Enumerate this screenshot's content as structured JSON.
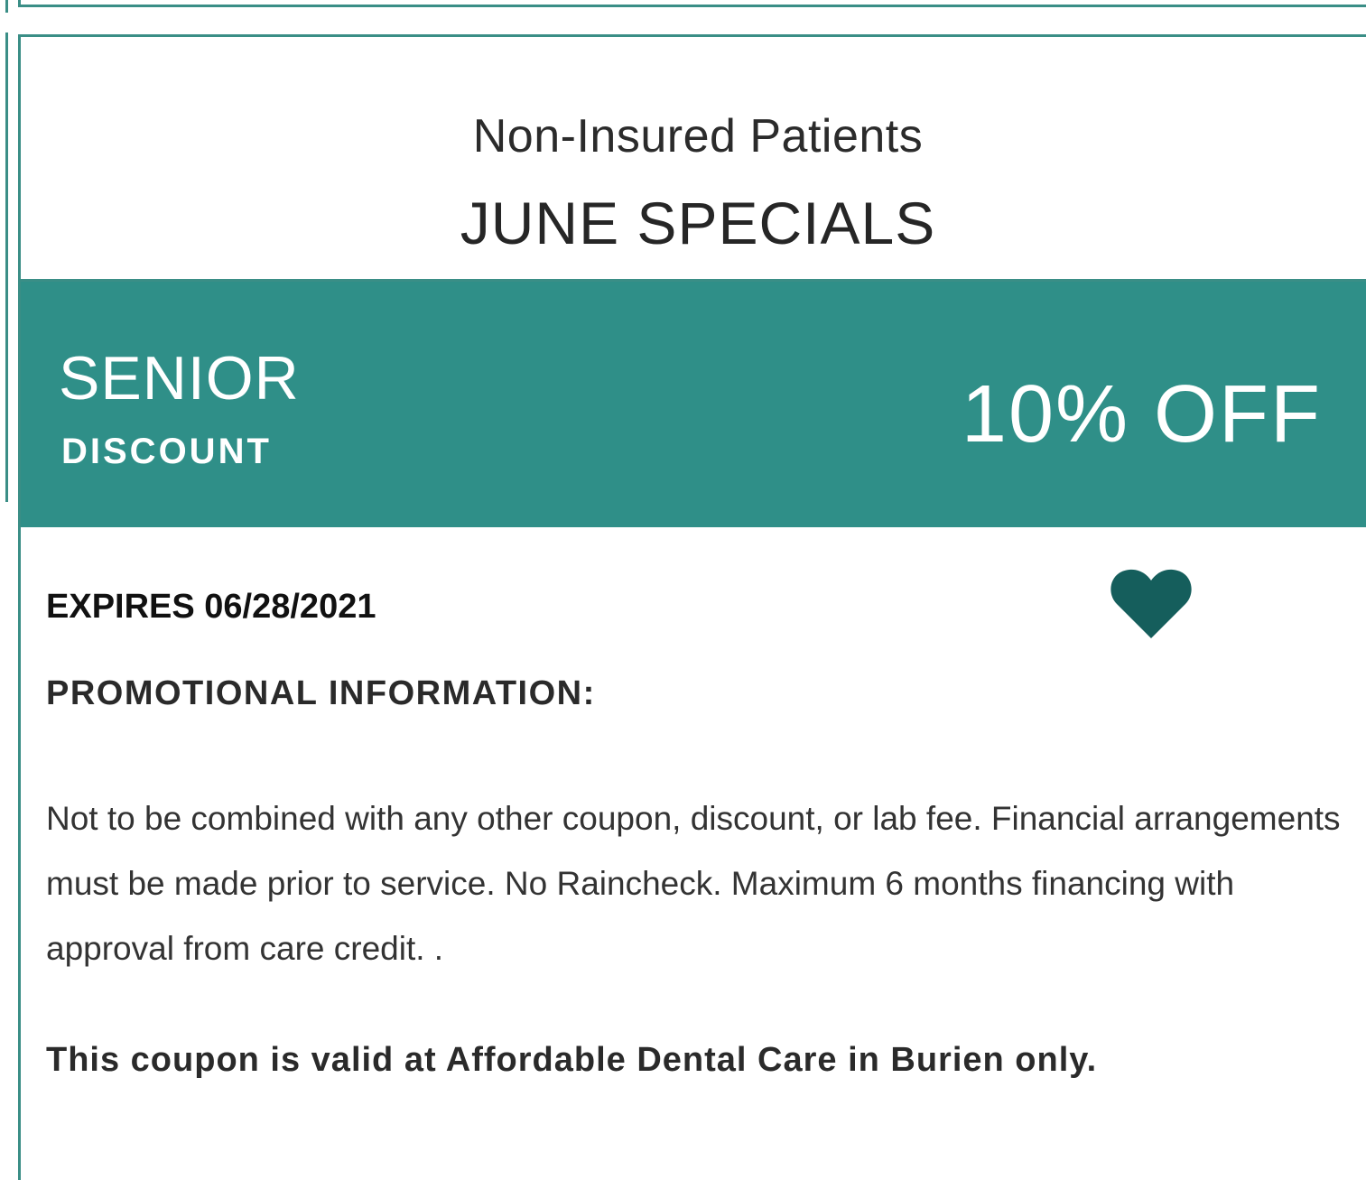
{
  "coupon": {
    "subtitle": "Non-Insured Patients",
    "title": "JUNE SPECIALS",
    "band": {
      "primary": "SENIOR",
      "secondary": "DISCOUNT",
      "amount": "10% OFF"
    },
    "expires": "EXPIRES 06/28/2021",
    "favorite_icon": "heart-icon",
    "promo_heading": "PROMOTIONAL INFORMATION:",
    "promo_body": "Not to be combined with any other coupon, discount, or lab fee. Financial arrangements must be made prior to service. No Raincheck. Maximum 6 months financing with approval from care credit. .",
    "validity": "This coupon is valid at Affordable Dental Care in Burien only."
  },
  "colors": {
    "accent": "#2f8f88",
    "border": "#3a8e86",
    "heart": "#155e5c"
  }
}
